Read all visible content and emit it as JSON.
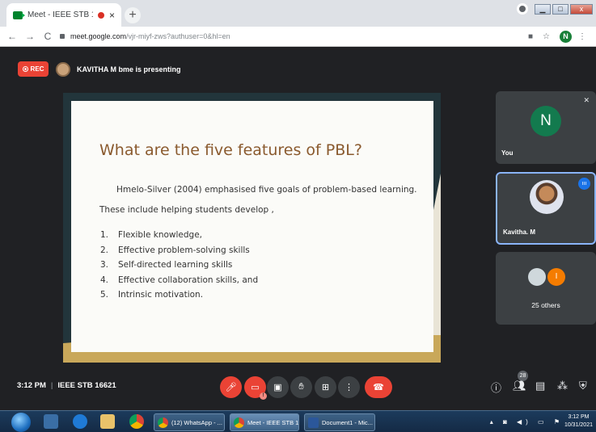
{
  "browser": {
    "tab_title": "Meet - IEEE STB 16621",
    "tab_close": "×",
    "new_tab": "+",
    "back": "←",
    "forward": "→",
    "reload": "C",
    "url_host": "meet.google.com",
    "url_path": "/vjr-miyf-zws?authuser=0&hl=en",
    "profile_initial": "N",
    "star": "☆"
  },
  "presenting": {
    "rec_label": "REC",
    "presenter_text": "KAVITHA M bme is presenting"
  },
  "slide": {
    "title": "What are the five features of PBL?",
    "intro": "Hmelo-Silver (2004) emphasised five goals of problem-based learning.",
    "lead": "These include helping students develop ,",
    "items": [
      {
        "num": "1.",
        "text": "Flexible knowledge,"
      },
      {
        "num": "2.",
        "text": "Effective problem-solving skills"
      },
      {
        "num": "3.",
        "text": "Self-directed learning skills"
      },
      {
        "num": "4.",
        "text": "Effective collaboration skills, and"
      },
      {
        "num": "5.",
        "text": "Intrinsic motivation."
      }
    ]
  },
  "participants": {
    "you": {
      "initial": "N",
      "name": "You"
    },
    "kavitha": {
      "name": "Kavitha. M"
    },
    "others": {
      "initial": "I",
      "label": "25 others"
    },
    "count_badge": "28"
  },
  "meeting": {
    "time": "3:12 PM",
    "code": "IEEE STB 16621",
    "separator": "|"
  },
  "taskbar": {
    "task1": "(12) WhatsApp - ...",
    "task2": "Meet - IEEE STB 1...",
    "task3": "Document1 - Mic...",
    "time": "3:12 PM",
    "date": "10/31/2021"
  }
}
